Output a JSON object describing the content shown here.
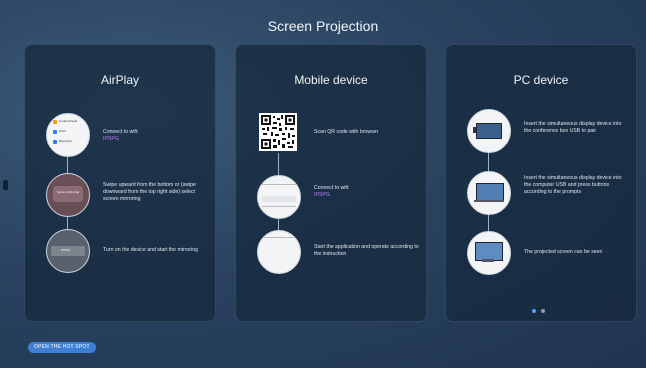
{
  "title": "Screen Projection",
  "airplay": {
    "title": "AirPlay",
    "steps": [
      {
        "text": "Connect to wifi:",
        "sub": "IPSPG",
        "menu": [
          "Control Panel",
          "Wi-Fi",
          "Bluetooth"
        ]
      },
      {
        "text": "Swipe upward from the bottom or (swipe downward from the top right side) select screen mirroring",
        "menu": [
          "Screen Mirroring"
        ]
      },
      {
        "text": "Turn on the device and start the mirroring",
        "menu": [
          "IPSPG"
        ]
      }
    ]
  },
  "mobile": {
    "title": "Mobile device",
    "steps": [
      {
        "text": "Scan QR code with browser"
      },
      {
        "text": "Connect to wifi:",
        "sub": "IPSPG"
      },
      {
        "text": "Start the application and operate according to the instruction"
      }
    ]
  },
  "pc": {
    "title": "PC device",
    "steps": [
      {
        "text": "Insert the simultaneous display device into the conference box USB to pair"
      },
      {
        "text": "Insert the simultaneous display device into the computer USB and press buttons according to the prompts"
      },
      {
        "text": "The projected screen can be seen"
      }
    ],
    "page_dots": 2
  },
  "hotspot_button": "OPEN THE HOT SPOT",
  "colors": {
    "accent": "#b77cff",
    "button": "#3e7fd6",
    "dot_active": "#4fa3ff"
  }
}
